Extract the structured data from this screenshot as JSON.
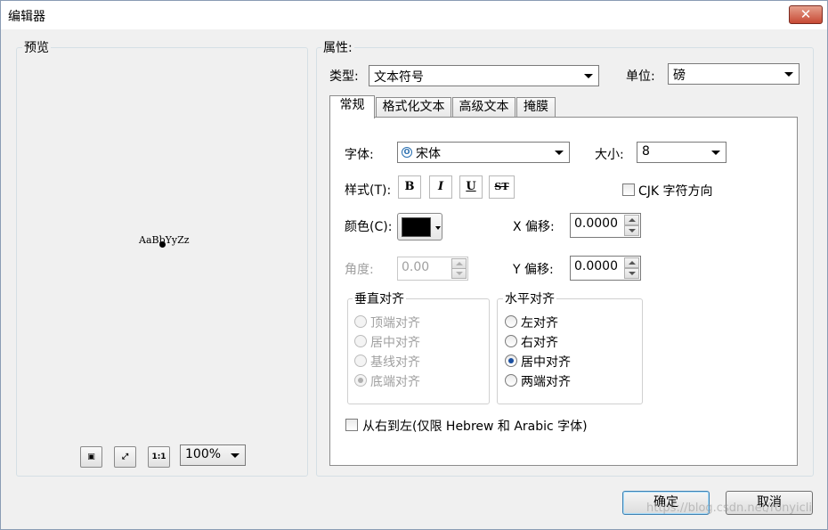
{
  "window": {
    "title": "编辑器",
    "close_label": "✕"
  },
  "preview": {
    "group_label": "预览",
    "sample_text": "AaBbYyZz",
    "zoom_value": "100%",
    "zoom_in_label": "⛶",
    "full_extent_label": "⤢",
    "one_to_one_label": "1:1"
  },
  "properties": {
    "group_label": "属性:",
    "type_label": "类型:",
    "type_value": "文本符号",
    "unit_label": "单位:",
    "unit_value": "磅"
  },
  "tabs": [
    {
      "label": "常规"
    },
    {
      "label": "格式化文本"
    },
    {
      "label": "高级文本"
    },
    {
      "label": "掩膜"
    }
  ],
  "general": {
    "font_label": "字体:",
    "font_value": "宋体",
    "font_icon": "opentype-font-icon",
    "size_label": "大小:",
    "size_value": "8",
    "style_label": "样式(T):",
    "bold_label": "B",
    "italic_label": "I",
    "underline_label": "U",
    "strike_label": "ST",
    "cjk_label": "CJK 字符方向",
    "color_label": "颜色(C):",
    "color_value": "#000000",
    "x_offset_label": "X 偏移:",
    "x_offset_value": "0.0000",
    "angle_label": "角度:",
    "angle_value": "0.00",
    "y_offset_label": "Y 偏移:",
    "y_offset_value": "0.0000"
  },
  "vertical_align": {
    "label": "垂直对齐",
    "options": [
      {
        "label": "顶端对齐",
        "checked": false
      },
      {
        "label": "居中对齐",
        "checked": false
      },
      {
        "label": "基线对齐",
        "checked": false
      },
      {
        "label": "底端对齐",
        "checked": true
      }
    ]
  },
  "horizontal_align": {
    "label": "水平对齐",
    "options": [
      {
        "label": "左对齐",
        "checked": false
      },
      {
        "label": "右对齐",
        "checked": false
      },
      {
        "label": "居中对齐",
        "checked": true
      },
      {
        "label": "两端对齐",
        "checked": false
      }
    ]
  },
  "rtl_label": "从右到左(仅限 Hebrew 和 Arabic 字体)",
  "buttons": {
    "ok": "确定",
    "cancel": "取消"
  },
  "watermark": "https://blog.csdn.net/ronyicli"
}
